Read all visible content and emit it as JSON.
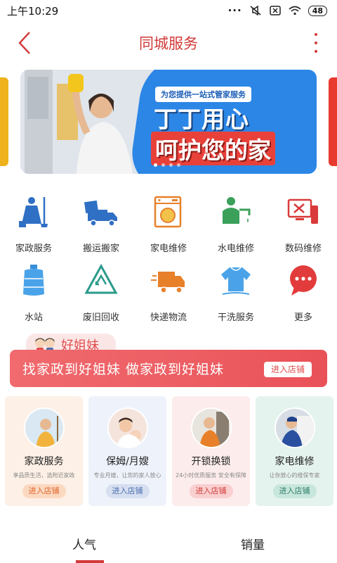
{
  "status_bar": {
    "time": "上午10:29",
    "dots": "···",
    "battery": "48"
  },
  "nav": {
    "title": "同城服务",
    "back_icon": "chevron-left-icon",
    "more_icon": "more-vertical-icon",
    "accent_color": "#d23a3a"
  },
  "banner": {
    "ribbon": "为您提供一站式管家服务",
    "line1": "丁丁用心",
    "line2": "呵护您的家",
    "dot_count": 4,
    "active_dot": 0
  },
  "services": [
    {
      "label": "家政服务",
      "icon": "housekeeping-icon"
    },
    {
      "label": "搬运搬家",
      "icon": "moving-truck-icon"
    },
    {
      "label": "家电维修",
      "icon": "washing-machine-icon"
    },
    {
      "label": "水电维修",
      "icon": "plumber-icon"
    },
    {
      "label": "数码维修",
      "icon": "digital-repair-icon"
    },
    {
      "label": "水站",
      "icon": "water-bottle-icon"
    },
    {
      "label": "废旧回收",
      "icon": "recycle-icon"
    },
    {
      "label": "快递物流",
      "icon": "delivery-truck-icon"
    },
    {
      "label": "干洗服务",
      "icon": "dry-clean-icon"
    },
    {
      "label": "更多",
      "icon": "more-chat-icon"
    }
  ],
  "promo": {
    "tag": "好姐妹",
    "slogan": "找家政到好姐妹  做家政到好姐妹",
    "button": "进入店铺"
  },
  "cards": [
    {
      "title": "家政服务",
      "subtitle": "享品质生活，选附近家政",
      "button": "进入店铺",
      "bg": "#fdf0e6",
      "btn_bg": "#fbd9c0",
      "btn_color": "#e2642c"
    },
    {
      "title": "保姆/月嫂",
      "subtitle": "专业月嫂，让您的家人放心",
      "button": "进入店铺",
      "bg": "#eef2fa",
      "btn_bg": "#d6dff0",
      "btn_color": "#4b6fb0"
    },
    {
      "title": "开锁换锁",
      "subtitle": "24小时优质服务 安全有保障",
      "button": "进入店铺",
      "bg": "#fdecec",
      "btn_bg": "#f9cfcf",
      "btn_color": "#d23a3a"
    },
    {
      "title": "家电维修",
      "subtitle": "让你放心的维保专家",
      "button": "进入店铺",
      "bg": "#e5f3ef",
      "btn_bg": "#c7e6dc",
      "btn_color": "#2e7d66"
    }
  ],
  "tabs": [
    {
      "label": "人气",
      "active": true
    },
    {
      "label": "销量",
      "active": false
    }
  ]
}
